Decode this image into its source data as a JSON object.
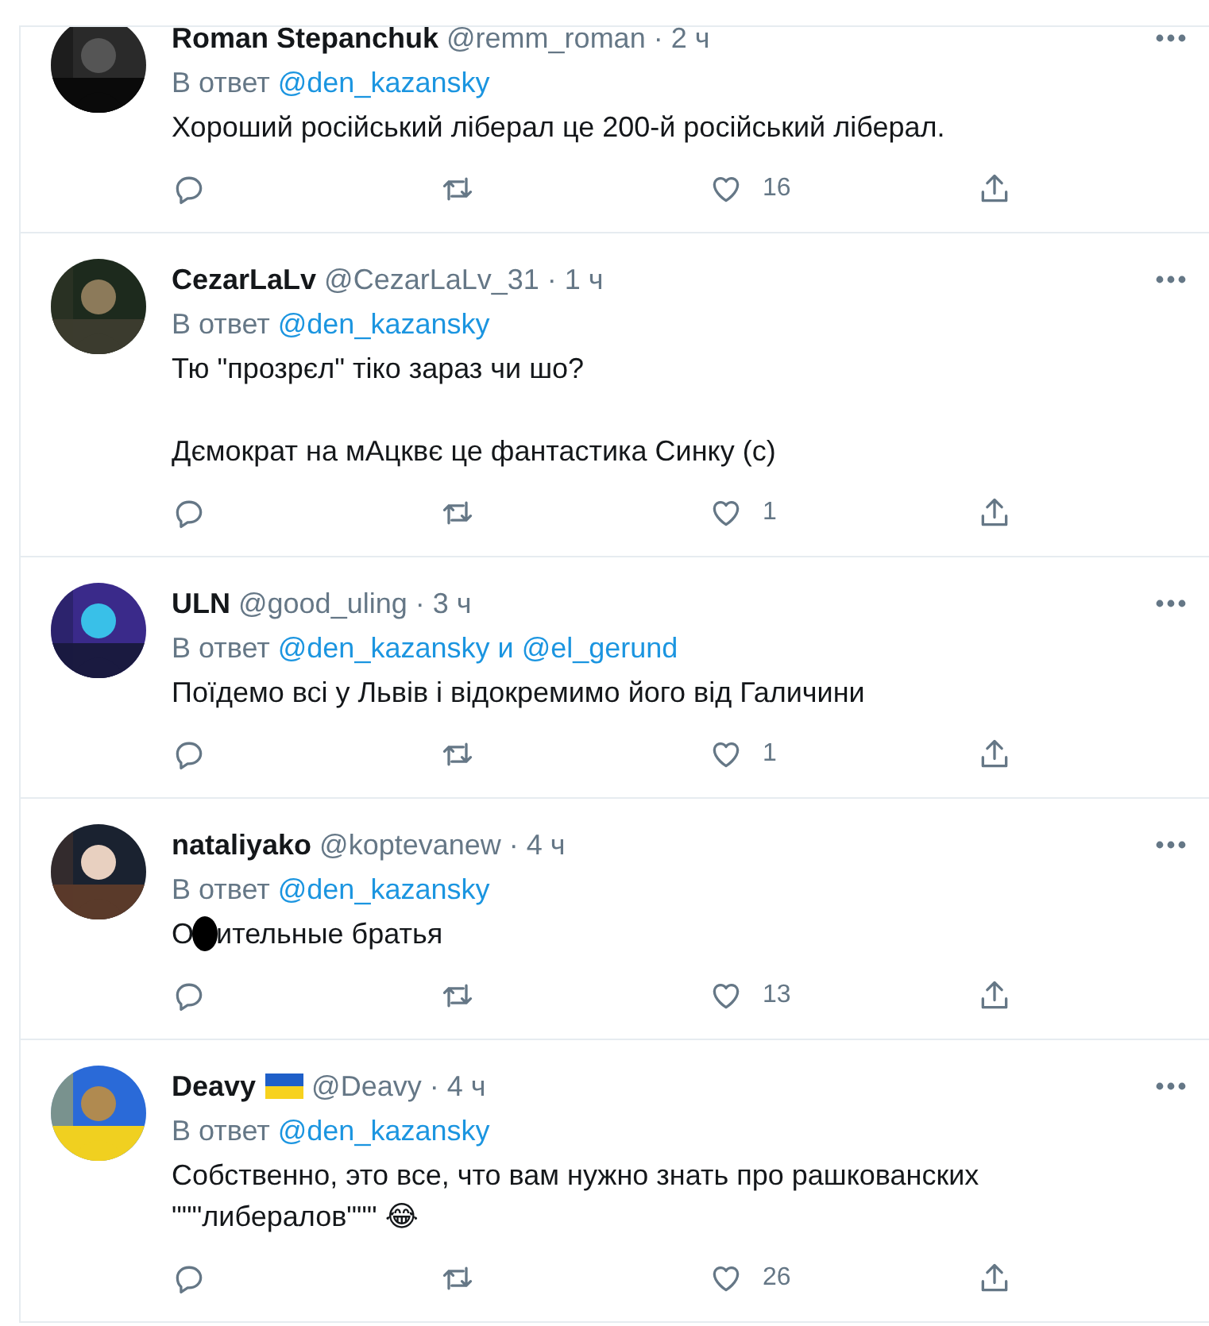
{
  "replies": [
    {
      "name": "Roman Stepanchuk",
      "flag": false,
      "handle": "@remm_roman",
      "separator": "·",
      "time": "2 ч",
      "reply_prefix": "В ответ",
      "mentions": [
        "@den_kazansky"
      ],
      "body": [
        {
          "kind": "line",
          "parts": [
            "Хороший російський ліберал це 200-й російський ліберал."
          ]
        }
      ],
      "likes": "16"
    },
    {
      "name": "CezarLaLv",
      "flag": false,
      "handle": "@CezarLaLv_31",
      "separator": "·",
      "time": "1 ч",
      "reply_prefix": "В ответ",
      "mentions": [
        "@den_kazansky"
      ],
      "body": [
        {
          "kind": "line",
          "parts": [
            "Тю \"прозрєл\" тіко зараз чи шо?"
          ]
        },
        {
          "kind": "blank"
        },
        {
          "kind": "line",
          "parts": [
            "Дємократ на мАцквє це фантастика Синку (с)"
          ]
        }
      ],
      "likes": "1"
    },
    {
      "name": "ULN",
      "flag": false,
      "handle": "@good_uling",
      "separator": "·",
      "time": "3 ч",
      "reply_prefix": "В ответ",
      "mentions": [
        "@den_kazansky",
        "@el_gerund"
      ],
      "joiner": "и",
      "body": [
        {
          "kind": "line",
          "parts": [
            "Поїдемо всі у Львів і відокремимо його від Галичини"
          ]
        }
      ],
      "likes": "1"
    },
    {
      "name": "nataliyako",
      "flag": false,
      "handle": "@koptevanew",
      "separator": "·",
      "time": "4 ч",
      "reply_prefix": "В ответ",
      "mentions": [
        "@den_kazansky"
      ],
      "body": [
        {
          "kind": "line",
          "parts": [
            "О",
            "ительные братья"
          ]
        }
      ],
      "likes": "13"
    },
    {
      "name": "Deavy",
      "flag": true,
      "handle": "@Deavy",
      "separator": "·",
      "time": "4 ч",
      "reply_prefix": "В ответ",
      "mentions": [
        "@den_kazansky"
      ],
      "body": [
        {
          "kind": "line",
          "parts": [
            "Собственно, это все, что вам нужно знать про рашкованских"
          ]
        },
        {
          "kind": "line",
          "parts": [
            "\"\"\"либералов\"\"\" 😂"
          ]
        }
      ],
      "likes": "26"
    }
  ]
}
